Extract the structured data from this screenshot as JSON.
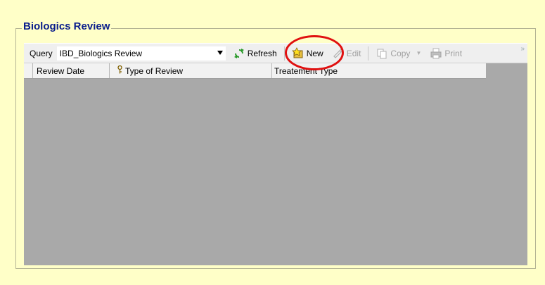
{
  "panel": {
    "title": "Biologics Review"
  },
  "toolbar": {
    "query_label": "Query",
    "query_value": "IBD_Biologics Review",
    "refresh_label": "Refresh",
    "new_label": "New",
    "edit_label": "Edit",
    "copy_label": "Copy",
    "print_label": "Print",
    "overflow": "»"
  },
  "grid": {
    "columns": [
      "Review Date",
      "Type of Review",
      "Treatement Type"
    ],
    "rows": []
  },
  "colors": {
    "background": "#ffffc8",
    "title": "#0a1e8c",
    "grid_empty": "#a9a9a9",
    "annotation_ring": "#e01010"
  }
}
